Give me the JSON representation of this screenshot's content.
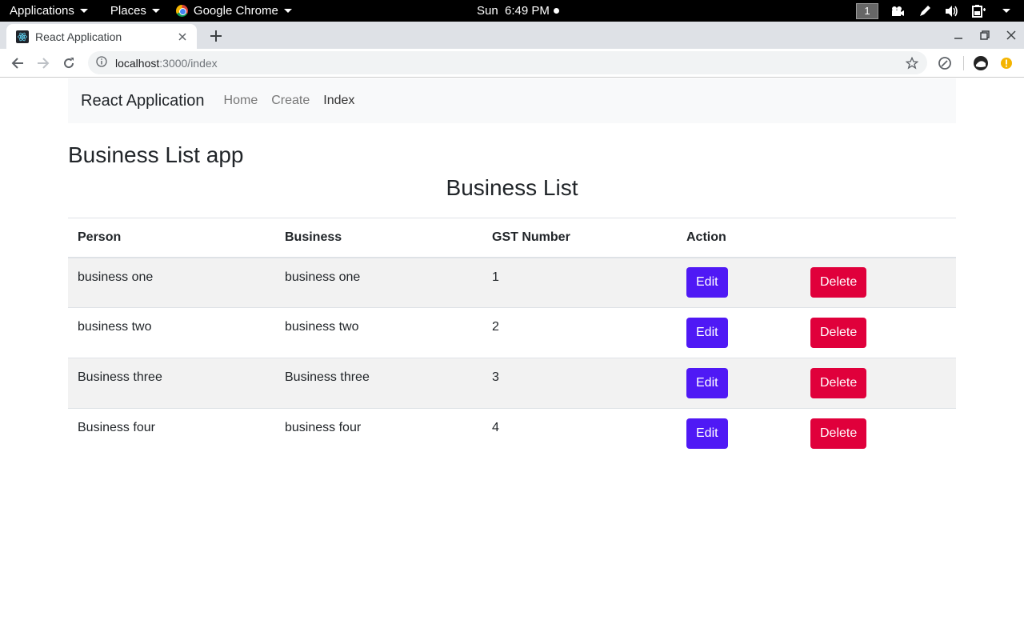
{
  "system_bar": {
    "applications": "Applications",
    "places": "Places",
    "chrome": "Google Chrome",
    "clock": "Sun  6:49 PM",
    "workspace": "1"
  },
  "browser": {
    "tab_title": "React Application",
    "url_host": "localhost",
    "url_path": ":3000/index"
  },
  "navbar": {
    "brand": "React Application",
    "links": [
      {
        "label": "Home",
        "active": false
      },
      {
        "label": "Create",
        "active": false
      },
      {
        "label": "Index",
        "active": true
      }
    ]
  },
  "page": {
    "app_title": "Business List app",
    "list_title": "Business List"
  },
  "table": {
    "headers": [
      "Person",
      "Business",
      "GST Number",
      "Action"
    ],
    "rows": [
      {
        "person": "business one",
        "business": "business one",
        "gst": "1"
      },
      {
        "person": "business two",
        "business": "business two",
        "gst": "2"
      },
      {
        "person": "Business three",
        "business": "Business three",
        "gst": "3"
      },
      {
        "person": "Business four",
        "business": "business four",
        "gst": "4"
      }
    ],
    "edit_label": "Edit",
    "delete_label": "Delete"
  },
  "colors": {
    "edit": "#4f19f5",
    "delete": "#e0003b"
  }
}
